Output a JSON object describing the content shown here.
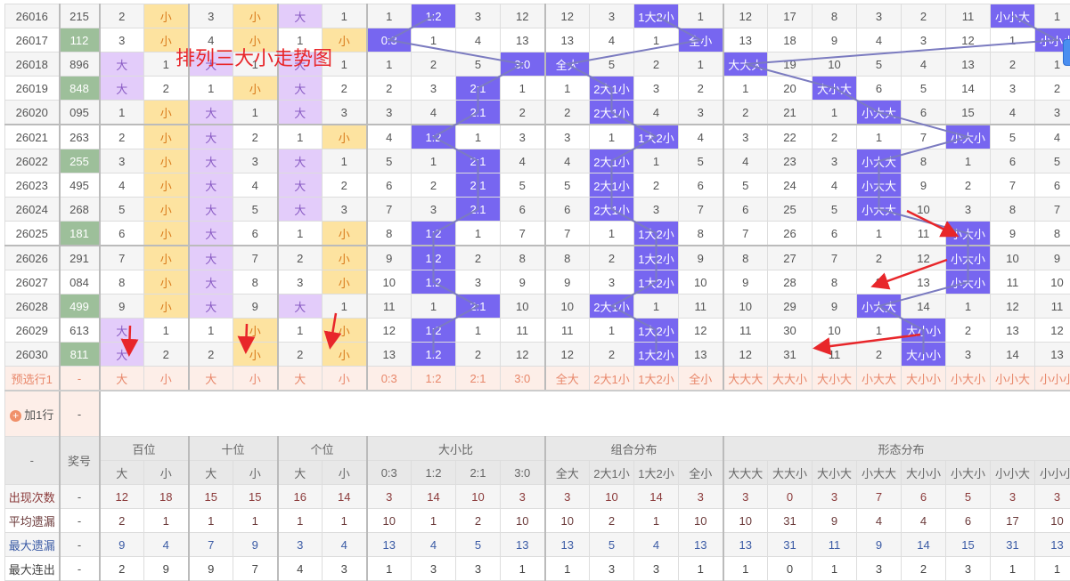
{
  "title": "排列三大小走势图",
  "colors": {
    "block": "#7766f0",
    "big": "#e3ccfa",
    "small": "#fde3a0",
    "green": "#9dbf9a",
    "line": "#7b7bc0",
    "arrow": "#e8262a"
  },
  "rows": [
    {
      "period": "26016",
      "number": "215",
      "hl": false,
      "cells": [
        "2",
        "小",
        "3",
        "小",
        "大",
        "1",
        "1",
        "1:2",
        "3",
        "12",
        "12",
        "3",
        "1大2小",
        "1",
        "12",
        "17",
        "8",
        "3",
        "2",
        "11",
        "小小大",
        "1"
      ]
    },
    {
      "period": "26017",
      "number": "112",
      "hl": true,
      "cells": [
        "3",
        "小",
        "4",
        "小",
        "1",
        "小",
        "0:3",
        "1",
        "4",
        "13",
        "13",
        "4",
        "1",
        "全小",
        "13",
        "18",
        "9",
        "4",
        "3",
        "12",
        "1",
        "小小小"
      ]
    },
    {
      "period": "26018",
      "number": "896",
      "hl": false,
      "cells": [
        "大",
        "1",
        "大",
        "1",
        "大",
        "1",
        "1",
        "2",
        "5",
        "3:0",
        "全大",
        "5",
        "2",
        "1",
        "大大大",
        "19",
        "10",
        "5",
        "4",
        "13",
        "2",
        "1"
      ]
    },
    {
      "period": "26019",
      "number": "848",
      "hl": true,
      "cells": [
        "大",
        "2",
        "1",
        "小",
        "大",
        "2",
        "2",
        "3",
        "2:1",
        "1",
        "1",
        "2大1小",
        "3",
        "2",
        "1",
        "20",
        "大小大",
        "6",
        "5",
        "14",
        "3",
        "2"
      ]
    },
    {
      "period": "26020",
      "number": "095",
      "hl": false,
      "cells": [
        "1",
        "小",
        "大",
        "1",
        "大",
        "3",
        "3",
        "4",
        "2:1",
        "2",
        "2",
        "2大1小",
        "4",
        "3",
        "2",
        "21",
        "1",
        "小大大",
        "6",
        "15",
        "4",
        "3"
      ]
    },
    {
      "period": "26021",
      "number": "263",
      "hl": false,
      "cells": [
        "2",
        "小",
        "大",
        "2",
        "1",
        "小",
        "4",
        "1:2",
        "1",
        "3",
        "3",
        "1",
        "1大2小",
        "4",
        "3",
        "22",
        "2",
        "1",
        "7",
        "小大小",
        "5",
        "4"
      ]
    },
    {
      "period": "26022",
      "number": "255",
      "hl": true,
      "cells": [
        "3",
        "小",
        "大",
        "3",
        "大",
        "1",
        "5",
        "1",
        "2:1",
        "4",
        "4",
        "2大1小",
        "1",
        "5",
        "4",
        "23",
        "3",
        "小大大",
        "8",
        "1",
        "6",
        "5"
      ]
    },
    {
      "period": "26023",
      "number": "495",
      "hl": false,
      "cells": [
        "4",
        "小",
        "大",
        "4",
        "大",
        "2",
        "6",
        "2",
        "2:1",
        "5",
        "5",
        "2大1小",
        "2",
        "6",
        "5",
        "24",
        "4",
        "小大大",
        "9",
        "2",
        "7",
        "6"
      ]
    },
    {
      "period": "26024",
      "number": "268",
      "hl": false,
      "cells": [
        "5",
        "小",
        "大",
        "5",
        "大",
        "3",
        "7",
        "3",
        "2:1",
        "6",
        "6",
        "2大1小",
        "3",
        "7",
        "6",
        "25",
        "5",
        "小大大",
        "10",
        "3",
        "8",
        "7"
      ]
    },
    {
      "period": "26025",
      "number": "181",
      "hl": true,
      "cells": [
        "6",
        "小",
        "大",
        "6",
        "1",
        "小",
        "8",
        "1:2",
        "1",
        "7",
        "7",
        "1",
        "1大2小",
        "8",
        "7",
        "26",
        "6",
        "1",
        "11",
        "小大小",
        "9",
        "8"
      ]
    },
    {
      "period": "26026",
      "number": "291",
      "hl": false,
      "cells": [
        "7",
        "小",
        "大",
        "7",
        "2",
        "小",
        "9",
        "1:2",
        "2",
        "8",
        "8",
        "2",
        "1大2小",
        "9",
        "8",
        "27",
        "7",
        "2",
        "12",
        "小大小",
        "10",
        "9"
      ]
    },
    {
      "period": "26027",
      "number": "084",
      "hl": false,
      "cells": [
        "8",
        "小",
        "大",
        "8",
        "3",
        "小",
        "10",
        "1:2",
        "3",
        "9",
        "9",
        "3",
        "1大2小",
        "10",
        "9",
        "28",
        "8",
        "3",
        "13",
        "小大小",
        "11",
        "10"
      ]
    },
    {
      "period": "26028",
      "number": "499",
      "hl": true,
      "cells": [
        "9",
        "小",
        "大",
        "9",
        "大",
        "1",
        "11",
        "1",
        "2:1",
        "10",
        "10",
        "2大1小",
        "1",
        "11",
        "10",
        "29",
        "9",
        "小大大",
        "14",
        "1",
        "12",
        "11"
      ]
    },
    {
      "period": "26029",
      "number": "613",
      "hl": false,
      "cells": [
        "大",
        "1",
        "1",
        "小",
        "1",
        "小",
        "12",
        "1:2",
        "1",
        "11",
        "11",
        "1",
        "1大2小",
        "12",
        "11",
        "30",
        "10",
        "1",
        "大小小",
        "2",
        "13",
        "12"
      ]
    },
    {
      "period": "26030",
      "number": "811",
      "hl": true,
      "cells": [
        "大",
        "2",
        "2",
        "小",
        "2",
        "小",
        "13",
        "1:2",
        "2",
        "12",
        "12",
        "2",
        "1大2小",
        "13",
        "12",
        "31",
        "11",
        "2",
        "大小小",
        "3",
        "14",
        "13"
      ]
    }
  ],
  "preselect": {
    "label": "预选行1",
    "number": "-",
    "cells": [
      "大",
      "小",
      "大",
      "小",
      "大",
      "小",
      "0:3",
      "1:2",
      "2:1",
      "3:0",
      "全大",
      "2大1小",
      "1大2小",
      "全小",
      "大大大",
      "大大小",
      "大小大",
      "小大大",
      "大小小",
      "小大小",
      "小小大",
      "小小小"
    ]
  },
  "add_row": {
    "label": "加1行",
    "number": "-"
  },
  "header": {
    "corner": "-",
    "number_label": "奖号",
    "groups": [
      {
        "label": "百位",
        "span": 2
      },
      {
        "label": "十位",
        "span": 2
      },
      {
        "label": "个位",
        "span": 2
      },
      {
        "label": "大小比",
        "span": 4
      },
      {
        "label": "组合分布",
        "span": 4
      },
      {
        "label": "形态分布",
        "span": 8
      }
    ],
    "subs": [
      "大",
      "小",
      "大",
      "小",
      "大",
      "小",
      "0:3",
      "1:2",
      "2:1",
      "3:0",
      "全大",
      "2大1小",
      "1大2小",
      "全小",
      "大大大",
      "大大小",
      "大小大",
      "小大大",
      "大小小",
      "小大小",
      "小小大",
      "小小小"
    ]
  },
  "stats": [
    {
      "label": "出现次数",
      "number": "-",
      "values": [
        "12",
        "18",
        "15",
        "15",
        "16",
        "14",
        "3",
        "14",
        "10",
        "3",
        "3",
        "10",
        "14",
        "3",
        "3",
        "0",
        "3",
        "7",
        "6",
        "5",
        "3",
        "3"
      ]
    },
    {
      "label": "平均遗漏",
      "number": "-",
      "values": [
        "2",
        "1",
        "1",
        "1",
        "1",
        "1",
        "10",
        "1",
        "2",
        "10",
        "10",
        "2",
        "1",
        "10",
        "10",
        "31",
        "9",
        "4",
        "4",
        "6",
        "17",
        "10"
      ]
    },
    {
      "label": "最大遗漏",
      "number": "-",
      "values": [
        "9",
        "4",
        "7",
        "9",
        "3",
        "4",
        "13",
        "4",
        "5",
        "13",
        "13",
        "5",
        "4",
        "13",
        "13",
        "31",
        "11",
        "9",
        "14",
        "15",
        "31",
        "13"
      ]
    },
    {
      "label": "最大连出",
      "number": "-",
      "values": [
        "2",
        "9",
        "9",
        "7",
        "4",
        "3",
        "1",
        "3",
        "3",
        "1",
        "1",
        "3",
        "3",
        "1",
        "1",
        "0",
        "1",
        "3",
        "2",
        "3",
        "1",
        "1"
      ]
    }
  ]
}
